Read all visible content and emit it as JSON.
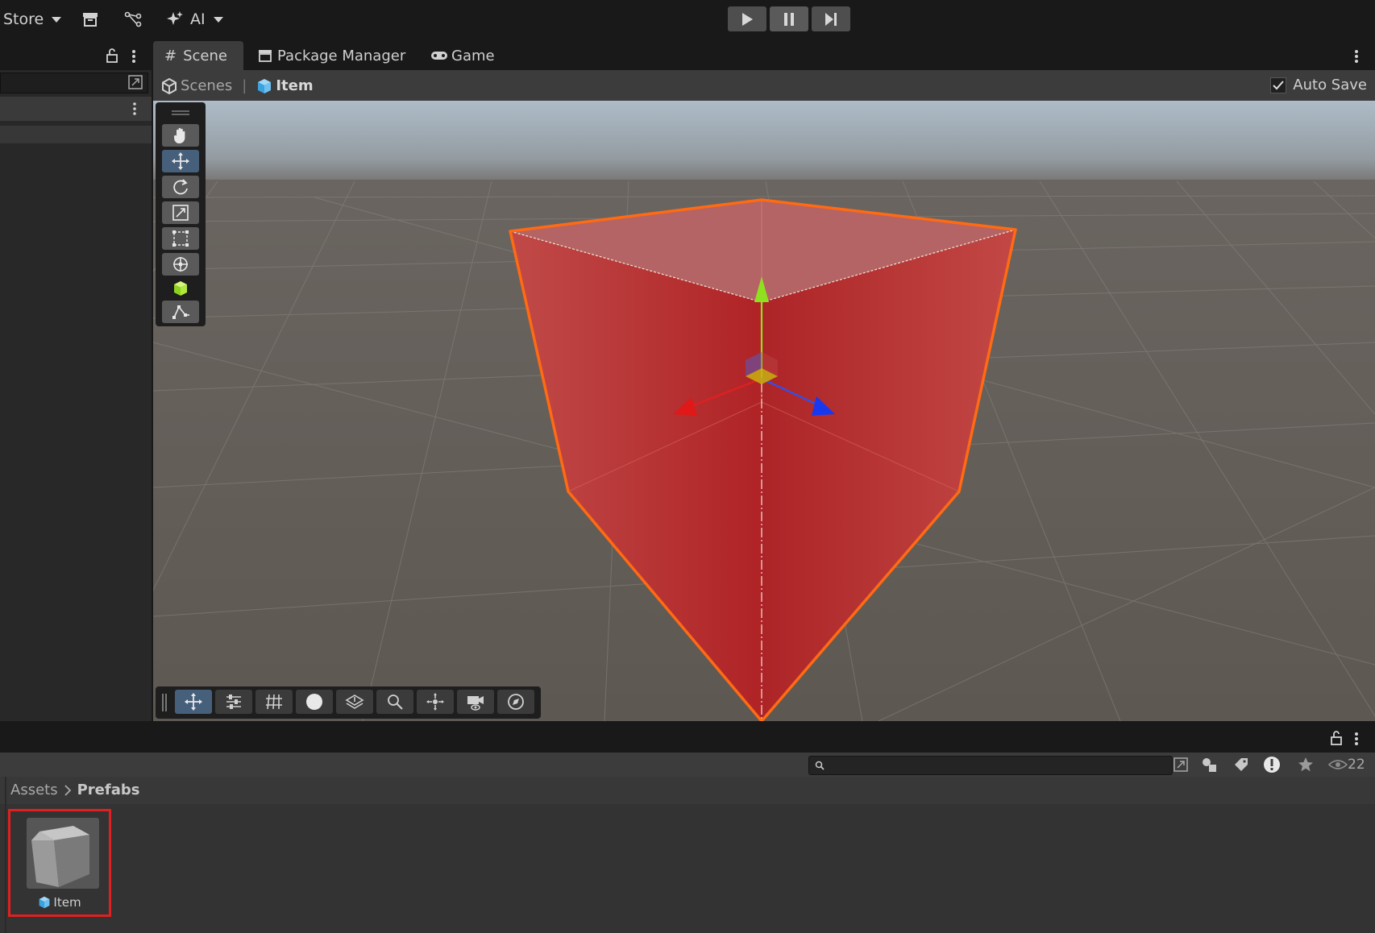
{
  "toolbar": {
    "store_label": "Store",
    "ai_label": "AI",
    "icons": [
      "archive-icon",
      "version-control-icon",
      "ai-sparkle-icon"
    ]
  },
  "playmode": {
    "buttons": [
      "play-icon",
      "pause-icon",
      "step-icon"
    ]
  },
  "tabs": [
    {
      "label": "Scene",
      "icon": "hash-icon",
      "active": true
    },
    {
      "label": "Package Manager",
      "icon": "package-icon",
      "active": false
    },
    {
      "label": "Game",
      "icon": "gamepad-icon",
      "active": false
    }
  ],
  "scene_header": {
    "breadcrumb_root": "Scenes",
    "breadcrumb_item": "Item",
    "auto_save_label": "Auto Save",
    "auto_save_checked": true
  },
  "tools": [
    "view-tool-hand-icon",
    "move-tool-icon",
    "rotate-tool-icon",
    "scale-tool-icon",
    "rect-tool-icon",
    "transform-tool-icon",
    "custom-tool-cube-icon",
    "spline-tool-icon"
  ],
  "overlay_toolbar": [
    "move-handle-icon",
    "settings-icon",
    "grid-icon",
    "shading-sphere-icon",
    "gizmo-layers-icon",
    "search-icon",
    "pivot-icon",
    "camera-icon",
    "compass-icon"
  ],
  "project": {
    "search_placeholder": "",
    "visible_count": "22",
    "breadcrumb": [
      "Assets",
      "Prefabs"
    ],
    "assets": [
      {
        "name": "Item",
        "type": "prefab",
        "selected": true
      }
    ]
  },
  "colors": {
    "accent": "#46607c",
    "selection_outline": "#ff6a13",
    "asset_highlight": "#e02020",
    "cube_fill": "#c4322c"
  }
}
